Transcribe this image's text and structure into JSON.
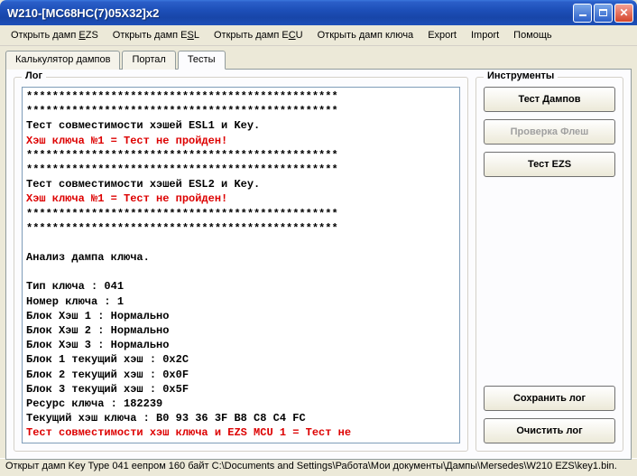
{
  "window": {
    "title": "W210-[MC68HC(7)05X32]x2"
  },
  "menu": {
    "open_ezs": "Открыть дамп EZS",
    "open_esl": "Открыть дамп ESL",
    "open_ecu": "Открыть дамп ECU",
    "open_key": "Открыть дамп ключа",
    "export": "Export",
    "import": "Import",
    "help": "Помощь"
  },
  "tabs": {
    "calc": "Калькулятор дампов",
    "portal": "Портал",
    "tests": "Тесты"
  },
  "group": {
    "log": "Лог",
    "tools": "Инструменты"
  },
  "buttons": {
    "test_dumps": "Тест Дампов",
    "check_flash": "Проверка Флеш",
    "test_ezs": "Тест EZS",
    "save_log": "Сохранить лог",
    "clear_log": "Очистить лог"
  },
  "log_lines": [
    {
      "t": "************************************************",
      "c": "black"
    },
    {
      "t": "************************************************",
      "c": "black"
    },
    {
      "t": "Тест совместимости хэшей ESL1 и Key.",
      "c": "black"
    },
    {
      "t": "Хэш ключа №1 = Тест не пройден!",
      "c": "red"
    },
    {
      "t": "************************************************",
      "c": "black"
    },
    {
      "t": "************************************************",
      "c": "black"
    },
    {
      "t": "Тест совместимости хэшей ESL2 и Key.",
      "c": "black"
    },
    {
      "t": "Хэш ключа №1 = Тест не пройден!",
      "c": "red"
    },
    {
      "t": "************************************************",
      "c": "black"
    },
    {
      "t": "************************************************",
      "c": "black"
    },
    {
      "t": "",
      "c": "black"
    },
    {
      "t": "Анализ дампа ключа.",
      "c": "black"
    },
    {
      "t": "",
      "c": "black"
    },
    {
      "t": "Тип ключа : 041",
      "c": "black"
    },
    {
      "t": "Номер ключа : 1",
      "c": "black"
    },
    {
      "t": "Блок Хэш 1 : Нормально",
      "c": "black"
    },
    {
      "t": "Блок Хэш 2 : Нормально",
      "c": "black"
    },
    {
      "t": "Блок Хэш 3 : Нормально",
      "c": "black"
    },
    {
      "t": "Блок 1 текущий хэш : 0x2C",
      "c": "black"
    },
    {
      "t": "Блок 2 текущий хэш : 0x0F",
      "c": "black"
    },
    {
      "t": "Блок 3 текущий хэш : 0x5F",
      "c": "black"
    },
    {
      "t": "Ресурс ключа : 182239",
      "c": "black"
    },
    {
      "t": "Текущий хэш ключа : B0 93 36 3F B8 C8 C4 FC",
      "c": "black"
    },
    {
      "t": "Тест совместимости хэш ключа и EZS MCU 1 = Тест не",
      "c": "red"
    }
  ],
  "status": "Открыт дамп Key Type 041 еепром 160 байт C:\\Documents and Settings\\Работа\\Мои документы\\Дампы\\Mersedes\\W210 EZS\\key1.bin."
}
